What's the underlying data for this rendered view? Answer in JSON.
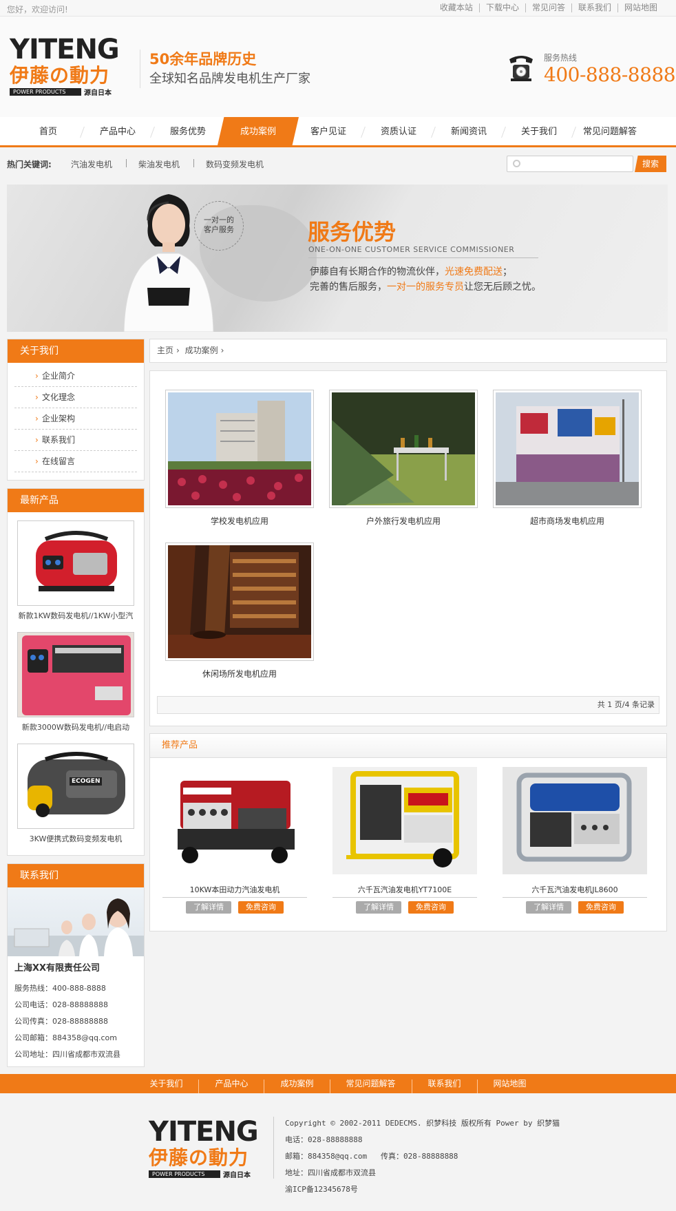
{
  "topbar": {
    "welcome": "您好，欢迎访问!",
    "links": [
      "收藏本站",
      "下载中心",
      "常见问答",
      "联系我们",
      "网站地图"
    ]
  },
  "header": {
    "logo_en": "YITENG",
    "logo_cn": "伊藤の動力",
    "logo_tag": "POWER PRODUCTS",
    "logo_tag2": "源自日本",
    "slogan_main": "50余年品牌历史",
    "slogan_sub": "全球知名品牌发电机生产厂家",
    "hotline_label": "服务热线",
    "hotline": "400-888-8888"
  },
  "nav": {
    "items": [
      "首页",
      "产品中心",
      "服务优势",
      "成功案例",
      "客户见证",
      "资质认证",
      "新闻资讯",
      "关于我们",
      "常见问题解答"
    ],
    "active": "成功案例"
  },
  "keywords": {
    "label": "热门关键词:",
    "items": [
      "汽油发电机",
      "柴油发电机",
      "数码变频发电机"
    ],
    "search_placeholder": "",
    "search_button": "搜索"
  },
  "banner": {
    "badge": "一对一的\n客户服务",
    "title": "服务优势",
    "subtitle": "ONE-ON-ONE CUSTOMER SERVICE COMMISSIONER",
    "line1_a": "伊藤自有长期合作的物流伙伴，",
    "line1_b": "光速免费配送",
    "line1_c": "；",
    "line2_a": "完善的售后服务，",
    "line2_b": "一对一的服务专员",
    "line2_c": "让您无后顾之忧。"
  },
  "sidebar": {
    "about_title": "关于我们",
    "about_items": [
      "企业简介",
      "文化理念",
      "企业架构",
      "联系我们",
      "在线留言"
    ],
    "products_title": "最新产品",
    "products": [
      "新款1KW数码发电机//1KW小型汽",
      "新款3000W数码发电机//电启动",
      "3KW便携式数码变频发电机"
    ],
    "product_badge": "ECOGEN",
    "contact_title": "联系我们",
    "company": "上海XX有限责任公司",
    "contact_rows": [
      "服务热线：400-888-8888",
      "公司电话：028-88888888",
      "公司传真：028-88888888",
      "公司邮箱：884358@qq.com",
      "公司地址：四川省成都市双流县"
    ]
  },
  "breadcrumb": {
    "home": "主页",
    "current": "成功案例"
  },
  "cases": {
    "items": [
      "学校发电机应用",
      "户外旅行发电机应用",
      "超市商场发电机应用",
      "休闲场所发电机应用"
    ],
    "pager": "共 1 页/4 条记录"
  },
  "recommend": {
    "title": "推荐产品",
    "items": [
      "10KW本田动力汽油发电机",
      "六千瓦汽油发电机YT7100E",
      "六千瓦汽油发电机JL8600"
    ],
    "detail_btn": "了解详情",
    "consult_btn": "免费咨询"
  },
  "footnav": [
    "关于我们",
    "产品中心",
    "成功案例",
    "常见问题解答",
    "联系我们",
    "网站地图"
  ],
  "footer": {
    "copyright": "Copyright © 2002-2011 DEDECMS. 织梦科技 版权所有 Power by 织梦猫",
    "phone": "电话：028-88888888",
    "email_fax": "邮箱：884358@qq.com   传真：028-88888888",
    "address": "地址：四川省成都市双流县",
    "icp": "渝ICP备12345678号"
  },
  "colors": {
    "accent": "#f07a17",
    "text": "#333333",
    "bg": "#f3f3f3"
  }
}
